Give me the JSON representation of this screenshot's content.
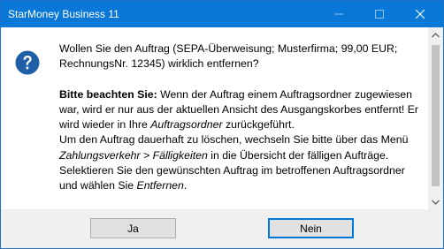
{
  "window": {
    "title": "StarMoney Business 11",
    "controls": {
      "minimize_icon": "minimize-icon",
      "maximize_icon": "maximize-icon",
      "close_icon": "close-icon"
    }
  },
  "colors": {
    "titlebar": "#0a78d7",
    "icon_blue": "#1e5fa8",
    "default_button_border": "#0078d7"
  },
  "message": {
    "icon": "question-icon",
    "question": "Wollen Sie den Auftrag (SEPA-Überweisung; Musterfirma; 99,00 EUR; RechnungsNr. 12345) wirklich entfernen?",
    "note_label": "Bitte beachten Sie:",
    "note_text_1": " Wenn der Auftrag einem Auftragsordner zugewiesen war, wird er nur aus der aktuellen Ansicht des Ausgangskorbes entfernt! Er wird wieder in Ihre ",
    "note_folder": "Auftragsordner",
    "note_text_2": " zurückgeführt.",
    "delete_text_1": "Um den Auftrag dauerhaft zu löschen, wechseln Sie bitte über das Menü ",
    "delete_menu": "Zahlungsverkehr > Fälligkeiten",
    "delete_text_2": " in die Übersicht der fälligen Aufträge. Selektieren Sie den gewünschten Auftrag im betroffenen Auftragsordner und wählen Sie ",
    "delete_action": "Entfernen",
    "delete_text_3": "."
  },
  "buttons": {
    "yes_label": "Ja",
    "no_label": "Nein"
  }
}
